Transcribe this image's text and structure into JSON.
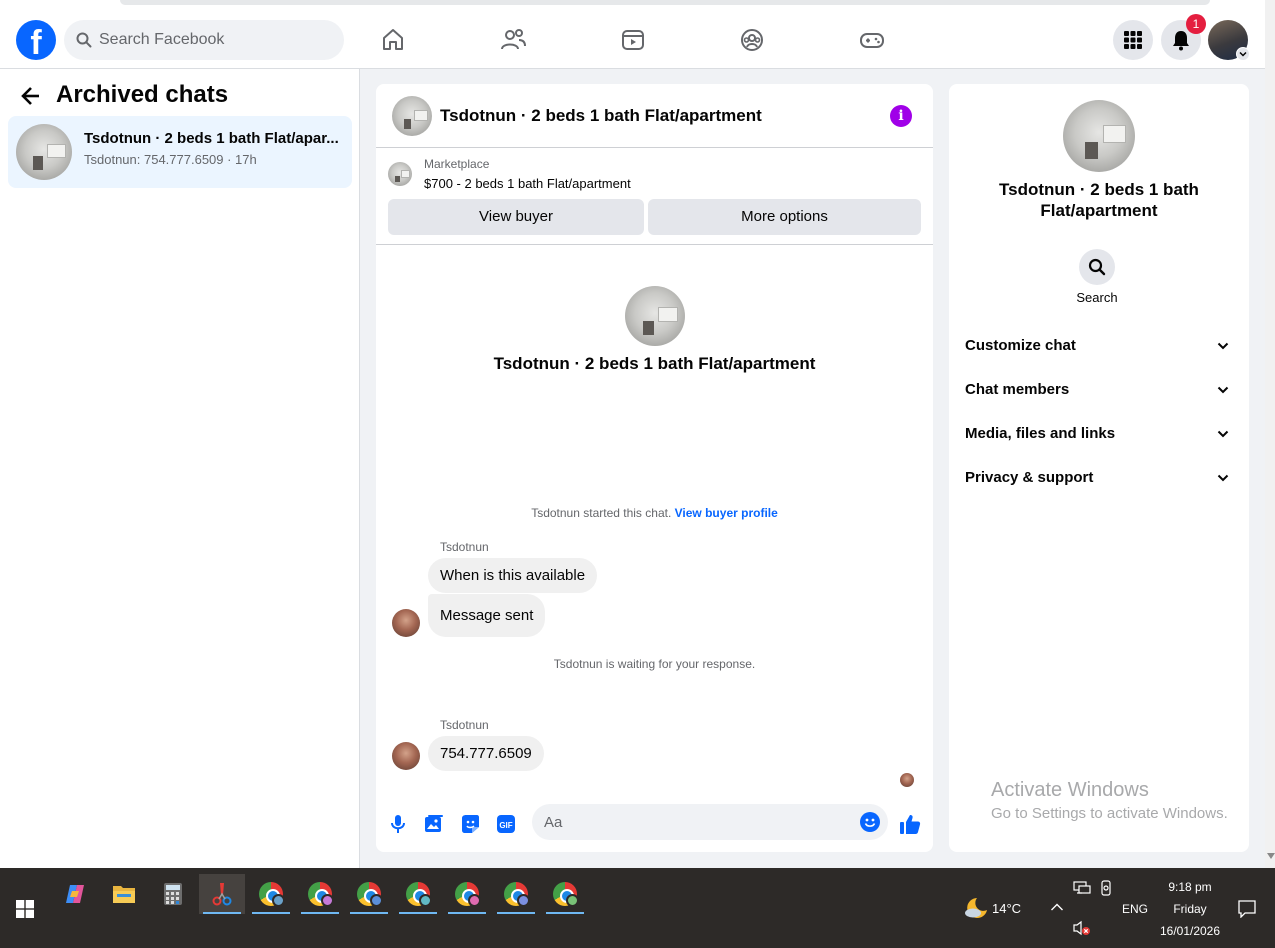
{
  "topbar": {
    "search_placeholder": "Search Facebook",
    "notification_count": "1"
  },
  "left": {
    "title": "Archived chats",
    "chats": [
      {
        "name": "Tsdotnun · 2 beds 1 bath Flat/apar...",
        "preview": "Tsdotnun: 754.777.6509 · 17h"
      }
    ]
  },
  "conversation": {
    "title": "Tsdotnun · 2 beds 1 bath Flat/apartment",
    "marketplace_label": "Marketplace",
    "listing": "$700 - 2 beds 1 bath Flat/apartment",
    "view_buyer": "View buyer",
    "more_options": "More options",
    "center_title": "Tsdotnun · 2 beds 1 bath Flat/apartment",
    "started_text": "Tsdotnun started this chat.",
    "view_buyer_profile": "View buyer profile",
    "sender1": "Tsdotnun",
    "msg1": "When is this available",
    "msg2": "Message sent",
    "waiting": "Tsdotnun is waiting for your response.",
    "sender2": "Tsdotnun",
    "msg3": "754.777.6509",
    "input_placeholder": "Aa",
    "gif_label": "GIF"
  },
  "right": {
    "title": "Tsdotnun · 2 beds 1 bath Flat/apartment",
    "search_label": "Search",
    "rows": [
      "Customize chat",
      "Chat members",
      "Media, files and links",
      "Privacy & support"
    ],
    "activate_title": "Activate Windows",
    "activate_sub": "Go to Settings to activate Windows."
  },
  "taskbar": {
    "temperature": "14°C",
    "language": "ENG",
    "time": "9:18 pm",
    "day": "Friday",
    "date": "16/01/2026"
  },
  "colors": {
    "facebook_blue": "#0866ff",
    "info_purple": "#a000e8",
    "badge_red": "#e41e3f",
    "active_chat_bg": "#ebf5ff"
  }
}
